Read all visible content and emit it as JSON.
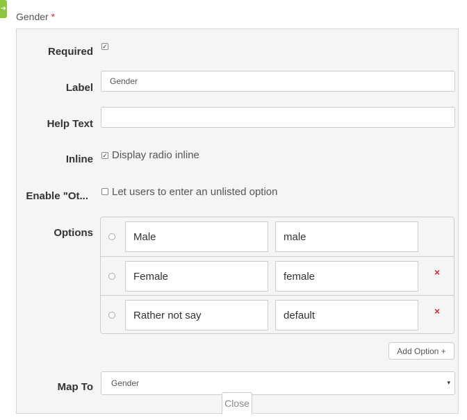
{
  "header": {
    "field_title": "Gender",
    "required_marker": "*",
    "handle_icon": "arrow-right-icon"
  },
  "form": {
    "required": {
      "label": "Required",
      "checked": true
    },
    "label": {
      "label": "Label",
      "value": "Gender",
      "placeholder": ""
    },
    "help_text": {
      "label": "Help Text",
      "value": "",
      "placeholder": ""
    },
    "inline": {
      "label": "Inline",
      "checked": true,
      "text": "Display radio inline"
    },
    "enable_other": {
      "label": "Enable \"Ot...",
      "checked": false,
      "text": "Let users to enter an unlisted option"
    },
    "options": {
      "label": "Options",
      "items": [
        {
          "label": "Male",
          "value": "male",
          "removable": false
        },
        {
          "label": "Female",
          "value": "female",
          "removable": true
        },
        {
          "label": "Rather not say",
          "value": "default",
          "removable": true
        }
      ],
      "remove_symbol": "×",
      "add_button": "Add Option +"
    },
    "map_to": {
      "label": "Map To",
      "selected": "Gender",
      "caret": "▾"
    }
  },
  "footer": {
    "close_label": "Close"
  },
  "colors": {
    "accent_green": "#8cc63f",
    "required_red": "#e02b2b",
    "remove_red": "#c9302c",
    "panel_bg": "#f5f5f5"
  }
}
